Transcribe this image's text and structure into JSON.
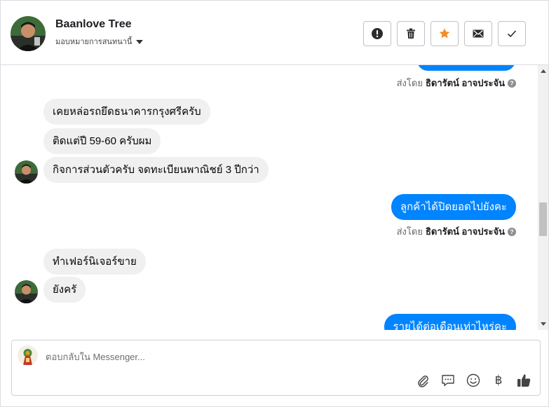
{
  "header": {
    "name": "Baanlove Tree",
    "assign_label": "มอบหมายการสนทนานี้",
    "actions": [
      {
        "name": "spam-icon"
      },
      {
        "name": "trash-icon"
      },
      {
        "name": "star-icon"
      },
      {
        "name": "mark-unread-icon"
      },
      {
        "name": "done-check-icon"
      }
    ],
    "star_color": "#f28c28"
  },
  "messages": {
    "sent_by_label": "ส่งโดย",
    "agent_name": "ธิดารัตน์ อาจประจัน",
    "incoming_1": "เคยหล่อรถยึดธนาคารกรุงศรีครับ",
    "incoming_2": "ติดแต่ปี 59-60 ครับผม",
    "incoming_3": "กิจการส่วนตัวครับ จดทะเบียนพาณิชย์ 3 ปีกว่า",
    "outgoing_1": "ลูกค้าได้ปิดยอดไปยังคะ",
    "incoming_4": "ทำเฟอร์นิเจอร์ขาย",
    "incoming_5": "ยังครั",
    "outgoing_2": "รายได้ต่อเดือนเท่าไหร่คะ",
    "help_glyph": "?",
    "bubble_out_color": "#0084ff"
  },
  "composer": {
    "placeholder": "ตอบกลับใน Messenger...",
    "tools": [
      "attachment-icon",
      "saved-replies-icon",
      "emoji-icon",
      "payment-baht-icon",
      "like-icon"
    ],
    "baht_glyph": "฿"
  }
}
